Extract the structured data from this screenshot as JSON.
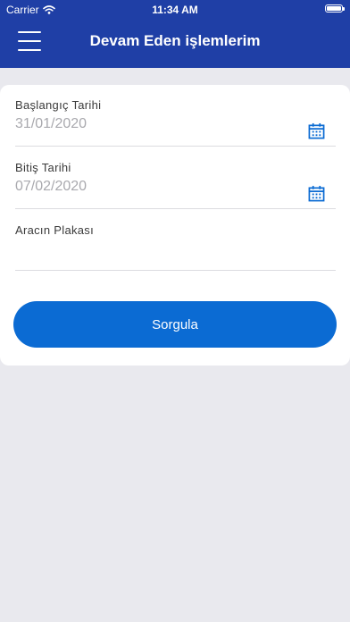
{
  "status_bar": {
    "carrier": "Carrier",
    "time": "11:34 AM",
    "wifi_icon": "wifi-icon",
    "battery_icon": "battery-icon"
  },
  "nav": {
    "title": "Devam Eden işlemlerim",
    "menu_icon": "hamburger-menu-icon"
  },
  "form": {
    "start_date": {
      "label": "Başlangıç Tarihi",
      "value": "31/01/2020",
      "icon": "calendar-icon"
    },
    "end_date": {
      "label": "Bitiş Tarihi",
      "value": "07/02/2020",
      "icon": "calendar-icon"
    },
    "plate": {
      "label": "Aracın Plakası",
      "value": ""
    },
    "submit_label": "Sorgula"
  },
  "colors": {
    "header": "#1f3fa6",
    "button": "#0b6bd3",
    "background": "#e9e9ee",
    "card": "#ffffff",
    "placeholder_text": "#a9a9ae"
  }
}
